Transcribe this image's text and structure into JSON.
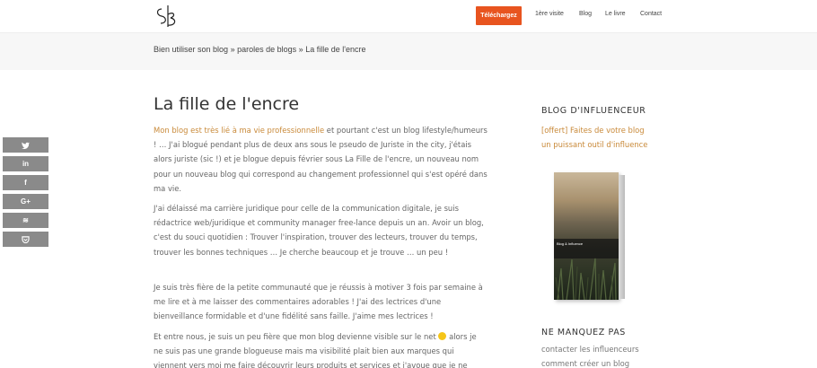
{
  "header": {
    "logo_text": "sB",
    "cta_label": "Téléchargez",
    "nav": [
      "1ère visite",
      "Blog",
      "Le livre",
      "Contact"
    ]
  },
  "breadcrumb": {
    "items": [
      "Bien utiliser son blog",
      "paroles de blogs",
      "La fille de l'encre"
    ],
    "separator": "»"
  },
  "social": [
    "twitter-icon",
    "linkedin-icon",
    "facebook-icon",
    "googleplus-icon",
    "buffer-icon",
    "pocket-icon"
  ],
  "social_glyphs": [
    "🐦",
    "in",
    "f",
    "G+",
    "≋",
    "⌵"
  ],
  "article": {
    "title": "La fille de l'encre",
    "p1_link": "Mon blog est très lié à ma vie professionnelle",
    "p1_rest": " et pourtant c'est un blog lifestyle/humeurs ! … J'ai blogué pendant plus de deux ans sous le pseudo de Juriste in the city, j'étais alors juriste (sic !) et je blogue depuis février sous La Fille de l'encre, un nouveau nom pour un nouveau blog qui correspond au changement professionnel qui s'est opéré dans ma vie.",
    "p2": "J'ai délaissé ma carrière juridique pour celle de la communication digitale, je suis rédactrice web/juridique et community manager free-lance depuis un an. Avoir un blog, c'est du souci quotidien : Trouver l'inspiration, trouver des lecteurs, trouver du temps, trouver les bonnes techniques … Je cherche beaucoup et je trouve … un peu !",
    "p3": "Je suis très fière de la petite communauté que je réussis à motiver 3 fois par semaine à me lire et à me laisser des commentaires adorables ! J'ai des lectrices d'une bienveillance formidable et d'une fidélité sans faille. J'aime mes lectrices !",
    "p4_a": "Et entre nous, je suis un peu fière que mon blog devienne visible sur le net ",
    "p4_b": " alors je ne suis pas une grande blogueuse mais ma visibilité plait bien aux marques qui viennent vers moi me faire découvrir leurs produits et services et j'avoue que je ne"
  },
  "sidebar": {
    "heading1": "BLOG D'INFLUENCEUR",
    "offer_line1": "[offert] Faites de votre blog",
    "offer_line2": "un puissant outil d'influence",
    "book_title": "Blog & Influence",
    "heading2": "NE MANQUEZ PAS",
    "items": [
      "contacter les influenceurs",
      "comment créer un blog"
    ]
  },
  "colors": {
    "accent": "#e8541f",
    "link": "#c98a3a",
    "social_bg": "#8a8a8a"
  }
}
